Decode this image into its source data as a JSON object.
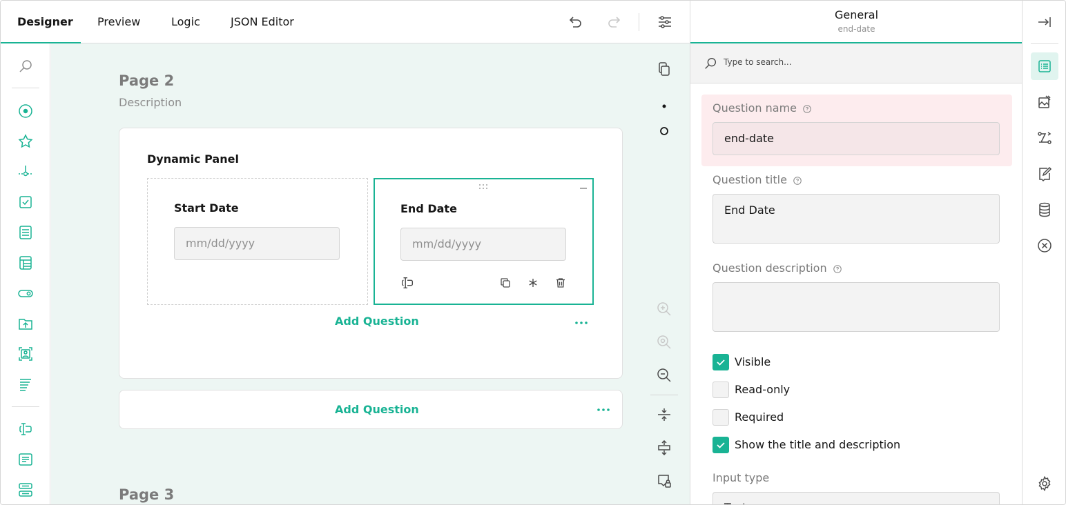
{
  "tabs": [
    "Designer",
    "Preview",
    "Logic",
    "JSON Editor"
  ],
  "canvas": {
    "page2": {
      "title": "Page 2",
      "description": "Description"
    },
    "panel": {
      "title": "Dynamic Panel",
      "start_label": "Start Date",
      "start_placeholder": "mm/dd/yyyy",
      "end_label": "End Date",
      "end_placeholder": "mm/dd/yyyy",
      "add_question": "Add Question"
    },
    "add_question": "Add Question",
    "page3": {
      "title": "Page 3"
    }
  },
  "property_grid": {
    "title": "General",
    "subtitle": "end-date",
    "search_placeholder": "Type to search...",
    "question_name_label": "Question name",
    "question_name_value": "end-date",
    "question_title_label": "Question title",
    "question_title_value": "End Date",
    "question_description_label": "Question description",
    "question_description_value": "",
    "checkboxes": [
      {
        "label": "Visible",
        "checked": true
      },
      {
        "label": "Read-only",
        "checked": false
      },
      {
        "label": "Required",
        "checked": false
      },
      {
        "label": "Show the title and description",
        "checked": true
      }
    ],
    "input_type_label": "Input type",
    "input_type_value": "Text"
  },
  "colors": {
    "accent": "#19b394",
    "canvas_bg": "#edf6f3",
    "error_bg": "#fdecee"
  },
  "icons": {
    "toolbox": [
      "search-icon",
      "radiogroup-icon",
      "rating-icon",
      "slider-icon",
      "checkbox-icon",
      "dropdown-icon",
      "matrix-icon",
      "boolean-icon",
      "file-upload-icon",
      "image-picker-icon",
      "ranking-icon",
      "text-input-icon",
      "comment-icon",
      "multiple-text-icon"
    ],
    "right_tabs": [
      "collapse-panel-icon",
      "general-icon",
      "layout-icon",
      "logic-icon",
      "validation-icon",
      "data-icon",
      "clear-icon",
      "settings-icon"
    ]
  }
}
